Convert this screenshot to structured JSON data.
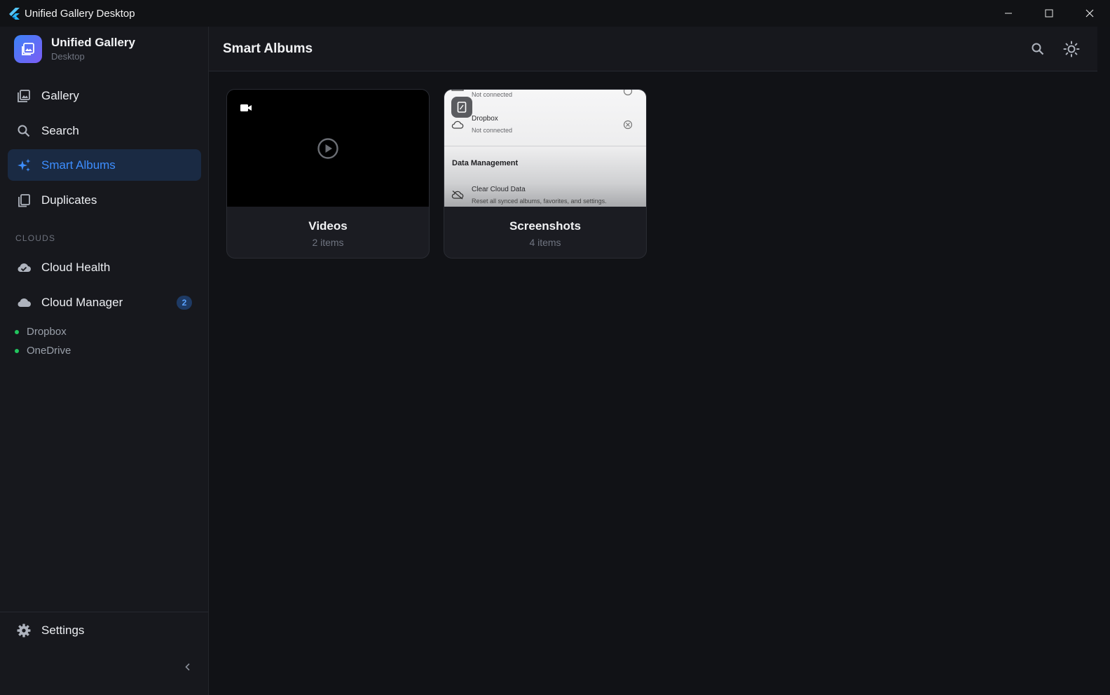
{
  "window": {
    "title": "Unified Gallery Desktop"
  },
  "sidebar": {
    "brand": {
      "name": "Unified Gallery",
      "subtitle": "Desktop"
    },
    "nav": [
      {
        "label": "Gallery",
        "icon": "gallery-icon"
      },
      {
        "label": "Search",
        "icon": "search-icon"
      },
      {
        "label": "Smart Albums",
        "icon": "sparkle-icon",
        "active": true
      },
      {
        "label": "Duplicates",
        "icon": "duplicates-icon"
      }
    ],
    "clouds_header": "CLOUDS",
    "clouds_nav": [
      {
        "label": "Cloud Health",
        "icon": "cloud-check-icon"
      },
      {
        "label": "Cloud Manager",
        "icon": "cloud-icon",
        "badge": "2"
      }
    ],
    "connected_clouds": [
      {
        "label": "Dropbox",
        "status_color": "#22c55e"
      },
      {
        "label": "OneDrive",
        "status_color": "#22c55e"
      }
    ],
    "settings_label": "Settings"
  },
  "header": {
    "title": "Smart Albums"
  },
  "albums": [
    {
      "name": "Videos",
      "count": "2 items",
      "thumbnail": "video-placeholder"
    },
    {
      "name": "Screenshots",
      "count": "4 items",
      "thumbnail": "screenshot-preview",
      "preview": {
        "top_status": "Not connected",
        "service_name": "Dropbox",
        "service_status": "Not connected",
        "section_title": "Data Management",
        "action_title": "Clear Cloud Data",
        "action_desc": "Reset all synced albums, favorites, and settings."
      }
    }
  ],
  "colors": {
    "accent": "#3d8eff",
    "active_bg": "#1a2a43",
    "status_online": "#22c55e"
  }
}
